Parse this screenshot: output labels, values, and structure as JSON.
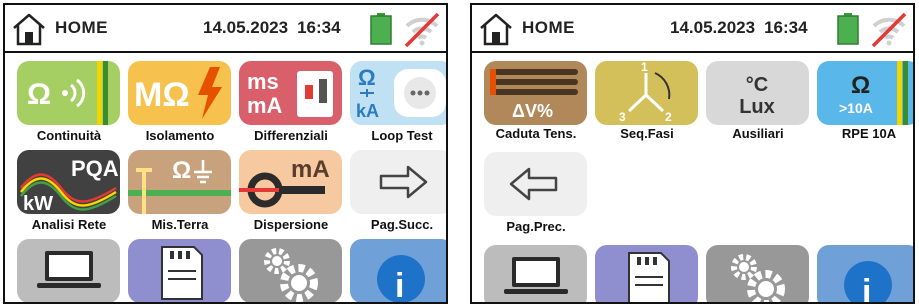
{
  "screens": [
    {
      "header": {
        "title": "HOME",
        "date": "14.05.2023",
        "time": "16:34"
      },
      "tiles": [
        {
          "label": "Continuità",
          "icon": "continuity-icon",
          "glyph": "Ω",
          "color": "#a6cf63"
        },
        {
          "label": "Isolamento",
          "icon": "insulation-icon",
          "glyph": "MΩ",
          "color": "#f6c24d"
        },
        {
          "label": "Differenziali",
          "icon": "rcd-icon",
          "glyph": "ms mA",
          "color": "#d9606b"
        },
        {
          "label": "Loop Test",
          "icon": "loop-test-icon",
          "glyph": "Ω kA",
          "color": "#bfe1f3"
        },
        {
          "label": "Analisi Rete",
          "icon": "power-quality-icon",
          "glyph": "PQA kW",
          "color": "#414141"
        },
        {
          "label": "Mis.Terra",
          "icon": "earth-resistance-icon",
          "glyph": "Ω",
          "color": "#c7a27c"
        },
        {
          "label": "Dispersione",
          "icon": "leakage-clamp-icon",
          "glyph": "mA",
          "color": "#f6c9a0"
        },
        {
          "label": "Pag.Succ.",
          "icon": "arrow-right-icon",
          "color": "#efefef"
        },
        {
          "label": "",
          "icon": "laptop-icon",
          "color": "#bcbcbc"
        },
        {
          "label": "",
          "icon": "memory-card-icon",
          "color": "#8f8fcf"
        },
        {
          "label": "",
          "icon": "gears-icon",
          "color": "#989898"
        },
        {
          "label": "",
          "icon": "info-icon",
          "color": "#6fa0d8"
        }
      ]
    },
    {
      "header": {
        "title": "HOME",
        "date": "14.05.2023",
        "time": "16:34"
      },
      "tiles": [
        {
          "label": "Caduta Tens.",
          "icon": "voltage-drop-icon",
          "glyph": "ΔV%",
          "color": "#b0885a"
        },
        {
          "label": "Seq.Fasi",
          "icon": "phase-sequence-icon",
          "glyph": "1 2 3",
          "color": "#d4c05a"
        },
        {
          "label": "Ausiliari",
          "icon": "auxiliary-icon",
          "glyph": "°C Lux",
          "color": "#d8d8d8"
        },
        {
          "label": "RPE 10A",
          "icon": "rpe-10a-icon",
          "glyph": "Ω >10A",
          "color": "#5ab7ea"
        },
        {
          "label": "Pag.Prec.",
          "icon": "arrow-left-icon",
          "color": "#efefef"
        },
        {
          "label": "",
          "icon": "laptop-icon",
          "color": "#bcbcbc"
        },
        {
          "label": "",
          "icon": "memory-card-icon",
          "color": "#8f8fcf"
        },
        {
          "label": "",
          "icon": "gears-icon",
          "color": "#989898"
        },
        {
          "label": "",
          "icon": "info-icon",
          "color": "#6fa0d8"
        }
      ]
    }
  ]
}
